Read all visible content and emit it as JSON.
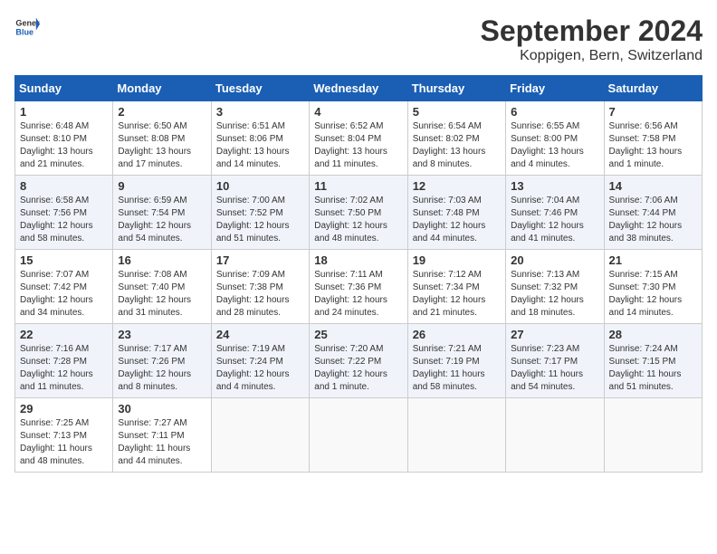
{
  "header": {
    "logo_general": "General",
    "logo_blue": "Blue",
    "month_title": "September 2024",
    "location": "Koppigen, Bern, Switzerland"
  },
  "days_of_week": [
    "Sunday",
    "Monday",
    "Tuesday",
    "Wednesday",
    "Thursday",
    "Friday",
    "Saturday"
  ],
  "weeks": [
    [
      {
        "day": "1",
        "sunrise": "Sunrise: 6:48 AM",
        "sunset": "Sunset: 8:10 PM",
        "daylight": "Daylight: 13 hours and 21 minutes."
      },
      {
        "day": "2",
        "sunrise": "Sunrise: 6:50 AM",
        "sunset": "Sunset: 8:08 PM",
        "daylight": "Daylight: 13 hours and 17 minutes."
      },
      {
        "day": "3",
        "sunrise": "Sunrise: 6:51 AM",
        "sunset": "Sunset: 8:06 PM",
        "daylight": "Daylight: 13 hours and 14 minutes."
      },
      {
        "day": "4",
        "sunrise": "Sunrise: 6:52 AM",
        "sunset": "Sunset: 8:04 PM",
        "daylight": "Daylight: 13 hours and 11 minutes."
      },
      {
        "day": "5",
        "sunrise": "Sunrise: 6:54 AM",
        "sunset": "Sunset: 8:02 PM",
        "daylight": "Daylight: 13 hours and 8 minutes."
      },
      {
        "day": "6",
        "sunrise": "Sunrise: 6:55 AM",
        "sunset": "Sunset: 8:00 PM",
        "daylight": "Daylight: 13 hours and 4 minutes."
      },
      {
        "day": "7",
        "sunrise": "Sunrise: 6:56 AM",
        "sunset": "Sunset: 7:58 PM",
        "daylight": "Daylight: 13 hours and 1 minute."
      }
    ],
    [
      {
        "day": "8",
        "sunrise": "Sunrise: 6:58 AM",
        "sunset": "Sunset: 7:56 PM",
        "daylight": "Daylight: 12 hours and 58 minutes."
      },
      {
        "day": "9",
        "sunrise": "Sunrise: 6:59 AM",
        "sunset": "Sunset: 7:54 PM",
        "daylight": "Daylight: 12 hours and 54 minutes."
      },
      {
        "day": "10",
        "sunrise": "Sunrise: 7:00 AM",
        "sunset": "Sunset: 7:52 PM",
        "daylight": "Daylight: 12 hours and 51 minutes."
      },
      {
        "day": "11",
        "sunrise": "Sunrise: 7:02 AM",
        "sunset": "Sunset: 7:50 PM",
        "daylight": "Daylight: 12 hours and 48 minutes."
      },
      {
        "day": "12",
        "sunrise": "Sunrise: 7:03 AM",
        "sunset": "Sunset: 7:48 PM",
        "daylight": "Daylight: 12 hours and 44 minutes."
      },
      {
        "day": "13",
        "sunrise": "Sunrise: 7:04 AM",
        "sunset": "Sunset: 7:46 PM",
        "daylight": "Daylight: 12 hours and 41 minutes."
      },
      {
        "day": "14",
        "sunrise": "Sunrise: 7:06 AM",
        "sunset": "Sunset: 7:44 PM",
        "daylight": "Daylight: 12 hours and 38 minutes."
      }
    ],
    [
      {
        "day": "15",
        "sunrise": "Sunrise: 7:07 AM",
        "sunset": "Sunset: 7:42 PM",
        "daylight": "Daylight: 12 hours and 34 minutes."
      },
      {
        "day": "16",
        "sunrise": "Sunrise: 7:08 AM",
        "sunset": "Sunset: 7:40 PM",
        "daylight": "Daylight: 12 hours and 31 minutes."
      },
      {
        "day": "17",
        "sunrise": "Sunrise: 7:09 AM",
        "sunset": "Sunset: 7:38 PM",
        "daylight": "Daylight: 12 hours and 28 minutes."
      },
      {
        "day": "18",
        "sunrise": "Sunrise: 7:11 AM",
        "sunset": "Sunset: 7:36 PM",
        "daylight": "Daylight: 12 hours and 24 minutes."
      },
      {
        "day": "19",
        "sunrise": "Sunrise: 7:12 AM",
        "sunset": "Sunset: 7:34 PM",
        "daylight": "Daylight: 12 hours and 21 minutes."
      },
      {
        "day": "20",
        "sunrise": "Sunrise: 7:13 AM",
        "sunset": "Sunset: 7:32 PM",
        "daylight": "Daylight: 12 hours and 18 minutes."
      },
      {
        "day": "21",
        "sunrise": "Sunrise: 7:15 AM",
        "sunset": "Sunset: 7:30 PM",
        "daylight": "Daylight: 12 hours and 14 minutes."
      }
    ],
    [
      {
        "day": "22",
        "sunrise": "Sunrise: 7:16 AM",
        "sunset": "Sunset: 7:28 PM",
        "daylight": "Daylight: 12 hours and 11 minutes."
      },
      {
        "day": "23",
        "sunrise": "Sunrise: 7:17 AM",
        "sunset": "Sunset: 7:26 PM",
        "daylight": "Daylight: 12 hours and 8 minutes."
      },
      {
        "day": "24",
        "sunrise": "Sunrise: 7:19 AM",
        "sunset": "Sunset: 7:24 PM",
        "daylight": "Daylight: 12 hours and 4 minutes."
      },
      {
        "day": "25",
        "sunrise": "Sunrise: 7:20 AM",
        "sunset": "Sunset: 7:22 PM",
        "daylight": "Daylight: 12 hours and 1 minute."
      },
      {
        "day": "26",
        "sunrise": "Sunrise: 7:21 AM",
        "sunset": "Sunset: 7:19 PM",
        "daylight": "Daylight: 11 hours and 58 minutes."
      },
      {
        "day": "27",
        "sunrise": "Sunrise: 7:23 AM",
        "sunset": "Sunset: 7:17 PM",
        "daylight": "Daylight: 11 hours and 54 minutes."
      },
      {
        "day": "28",
        "sunrise": "Sunrise: 7:24 AM",
        "sunset": "Sunset: 7:15 PM",
        "daylight": "Daylight: 11 hours and 51 minutes."
      }
    ],
    [
      {
        "day": "29",
        "sunrise": "Sunrise: 7:25 AM",
        "sunset": "Sunset: 7:13 PM",
        "daylight": "Daylight: 11 hours and 48 minutes."
      },
      {
        "day": "30",
        "sunrise": "Sunrise: 7:27 AM",
        "sunset": "Sunset: 7:11 PM",
        "daylight": "Daylight: 11 hours and 44 minutes."
      },
      null,
      null,
      null,
      null,
      null
    ]
  ]
}
